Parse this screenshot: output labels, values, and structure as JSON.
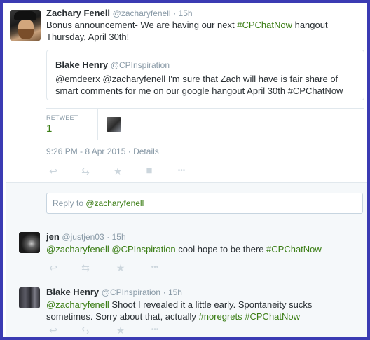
{
  "main_tweet": {
    "name": "Zachary Fenell",
    "handle": "@zacharyfenell",
    "time": "· 15h",
    "text_before": "Bonus announcement- We are having our next ",
    "hashtag": "#CPChatNow",
    "text_after": " hangout Thursday, April 30th!",
    "quote": {
      "name": "Blake Henry",
      "handle": "@CPInspiration",
      "mention1": "@emdeerx",
      "mention2": "@zacharyfenell",
      "text_middle": " I'm sure that Zach will have is fair share of smart comments for me on our google hangout April 30th ",
      "hashtag": "#CPChatNow"
    },
    "stats": {
      "label": "RETWEET",
      "count": "1"
    },
    "timestamp": "9:26 PM - 8 Apr 2015",
    "details_link": "Details"
  },
  "reply_box": {
    "prefix": "Reply to ",
    "mention": "@zacharyfenell"
  },
  "replies": [
    {
      "name": "jen",
      "handle": "@justjen03",
      "time": "· 15h",
      "mention1": "@zacharyfenell",
      "mention2": "@CPInspiration",
      "text_middle": " cool hope to be there ",
      "hashtag": "#CPChatNow"
    },
    {
      "name": "Blake Henry",
      "handle": "@CPInspiration",
      "time": "· 15h",
      "mention1": "@zacharyfenell",
      "text_middle": " Shoot I revealed it a little early. Spontaneity sucks sometimes. Sorry about that, actually ",
      "hashtag1": "#noregrets",
      "hashtag2": "#CPChatNow"
    }
  ],
  "icons": {
    "reply": "↩",
    "retweet": "⇆",
    "favorite": "★",
    "stats": "▮▮",
    "more": "•••"
  },
  "colors": {
    "frame": "#3b3bb3",
    "link_green": "#3a7d14",
    "muted": "#8899a6",
    "reply_bg": "#f5f8fa"
  }
}
